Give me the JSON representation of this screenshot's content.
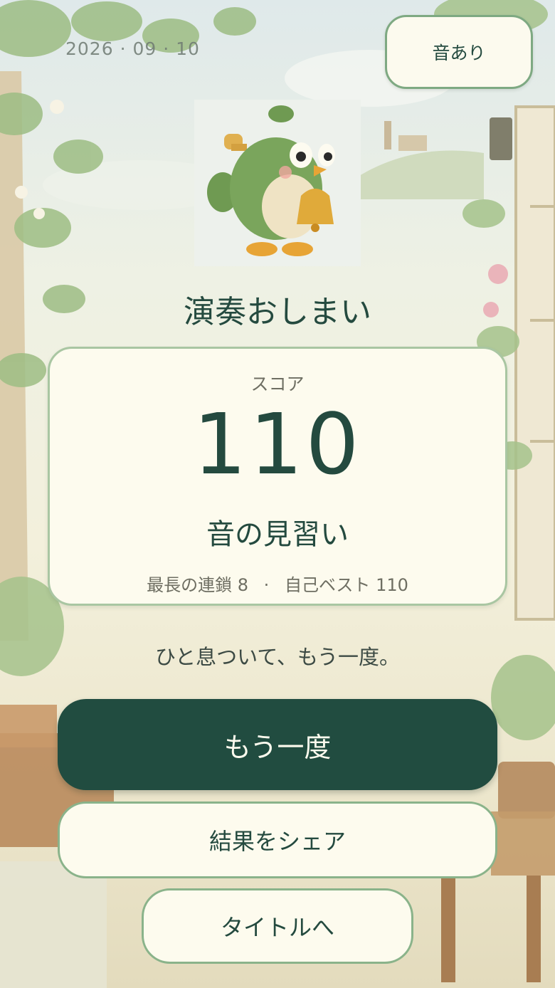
{
  "status": {
    "date": "2026 · 09 · 10"
  },
  "header": {
    "sound_toggle_label": "音あり"
  },
  "result": {
    "title": "演奏おしまい",
    "score_label": "スコア",
    "score_value": "110",
    "rank": "音の見習い",
    "longest_chain_label": "最長の連鎖",
    "longest_chain_value": "8",
    "separator": "·",
    "best_label": "自己ベスト",
    "best_value": "110",
    "message": "ひと息ついて、もう一度。"
  },
  "actions": {
    "retry_label": "もう一度",
    "share_label": "結果をシェア",
    "title_label": "タイトルへ"
  },
  "colors": {
    "primary": "#214c40",
    "card_background": "#fdfbee",
    "border_green": "#8ab38a"
  },
  "icons": {
    "mascot": "green-bird-with-bell-icon"
  }
}
